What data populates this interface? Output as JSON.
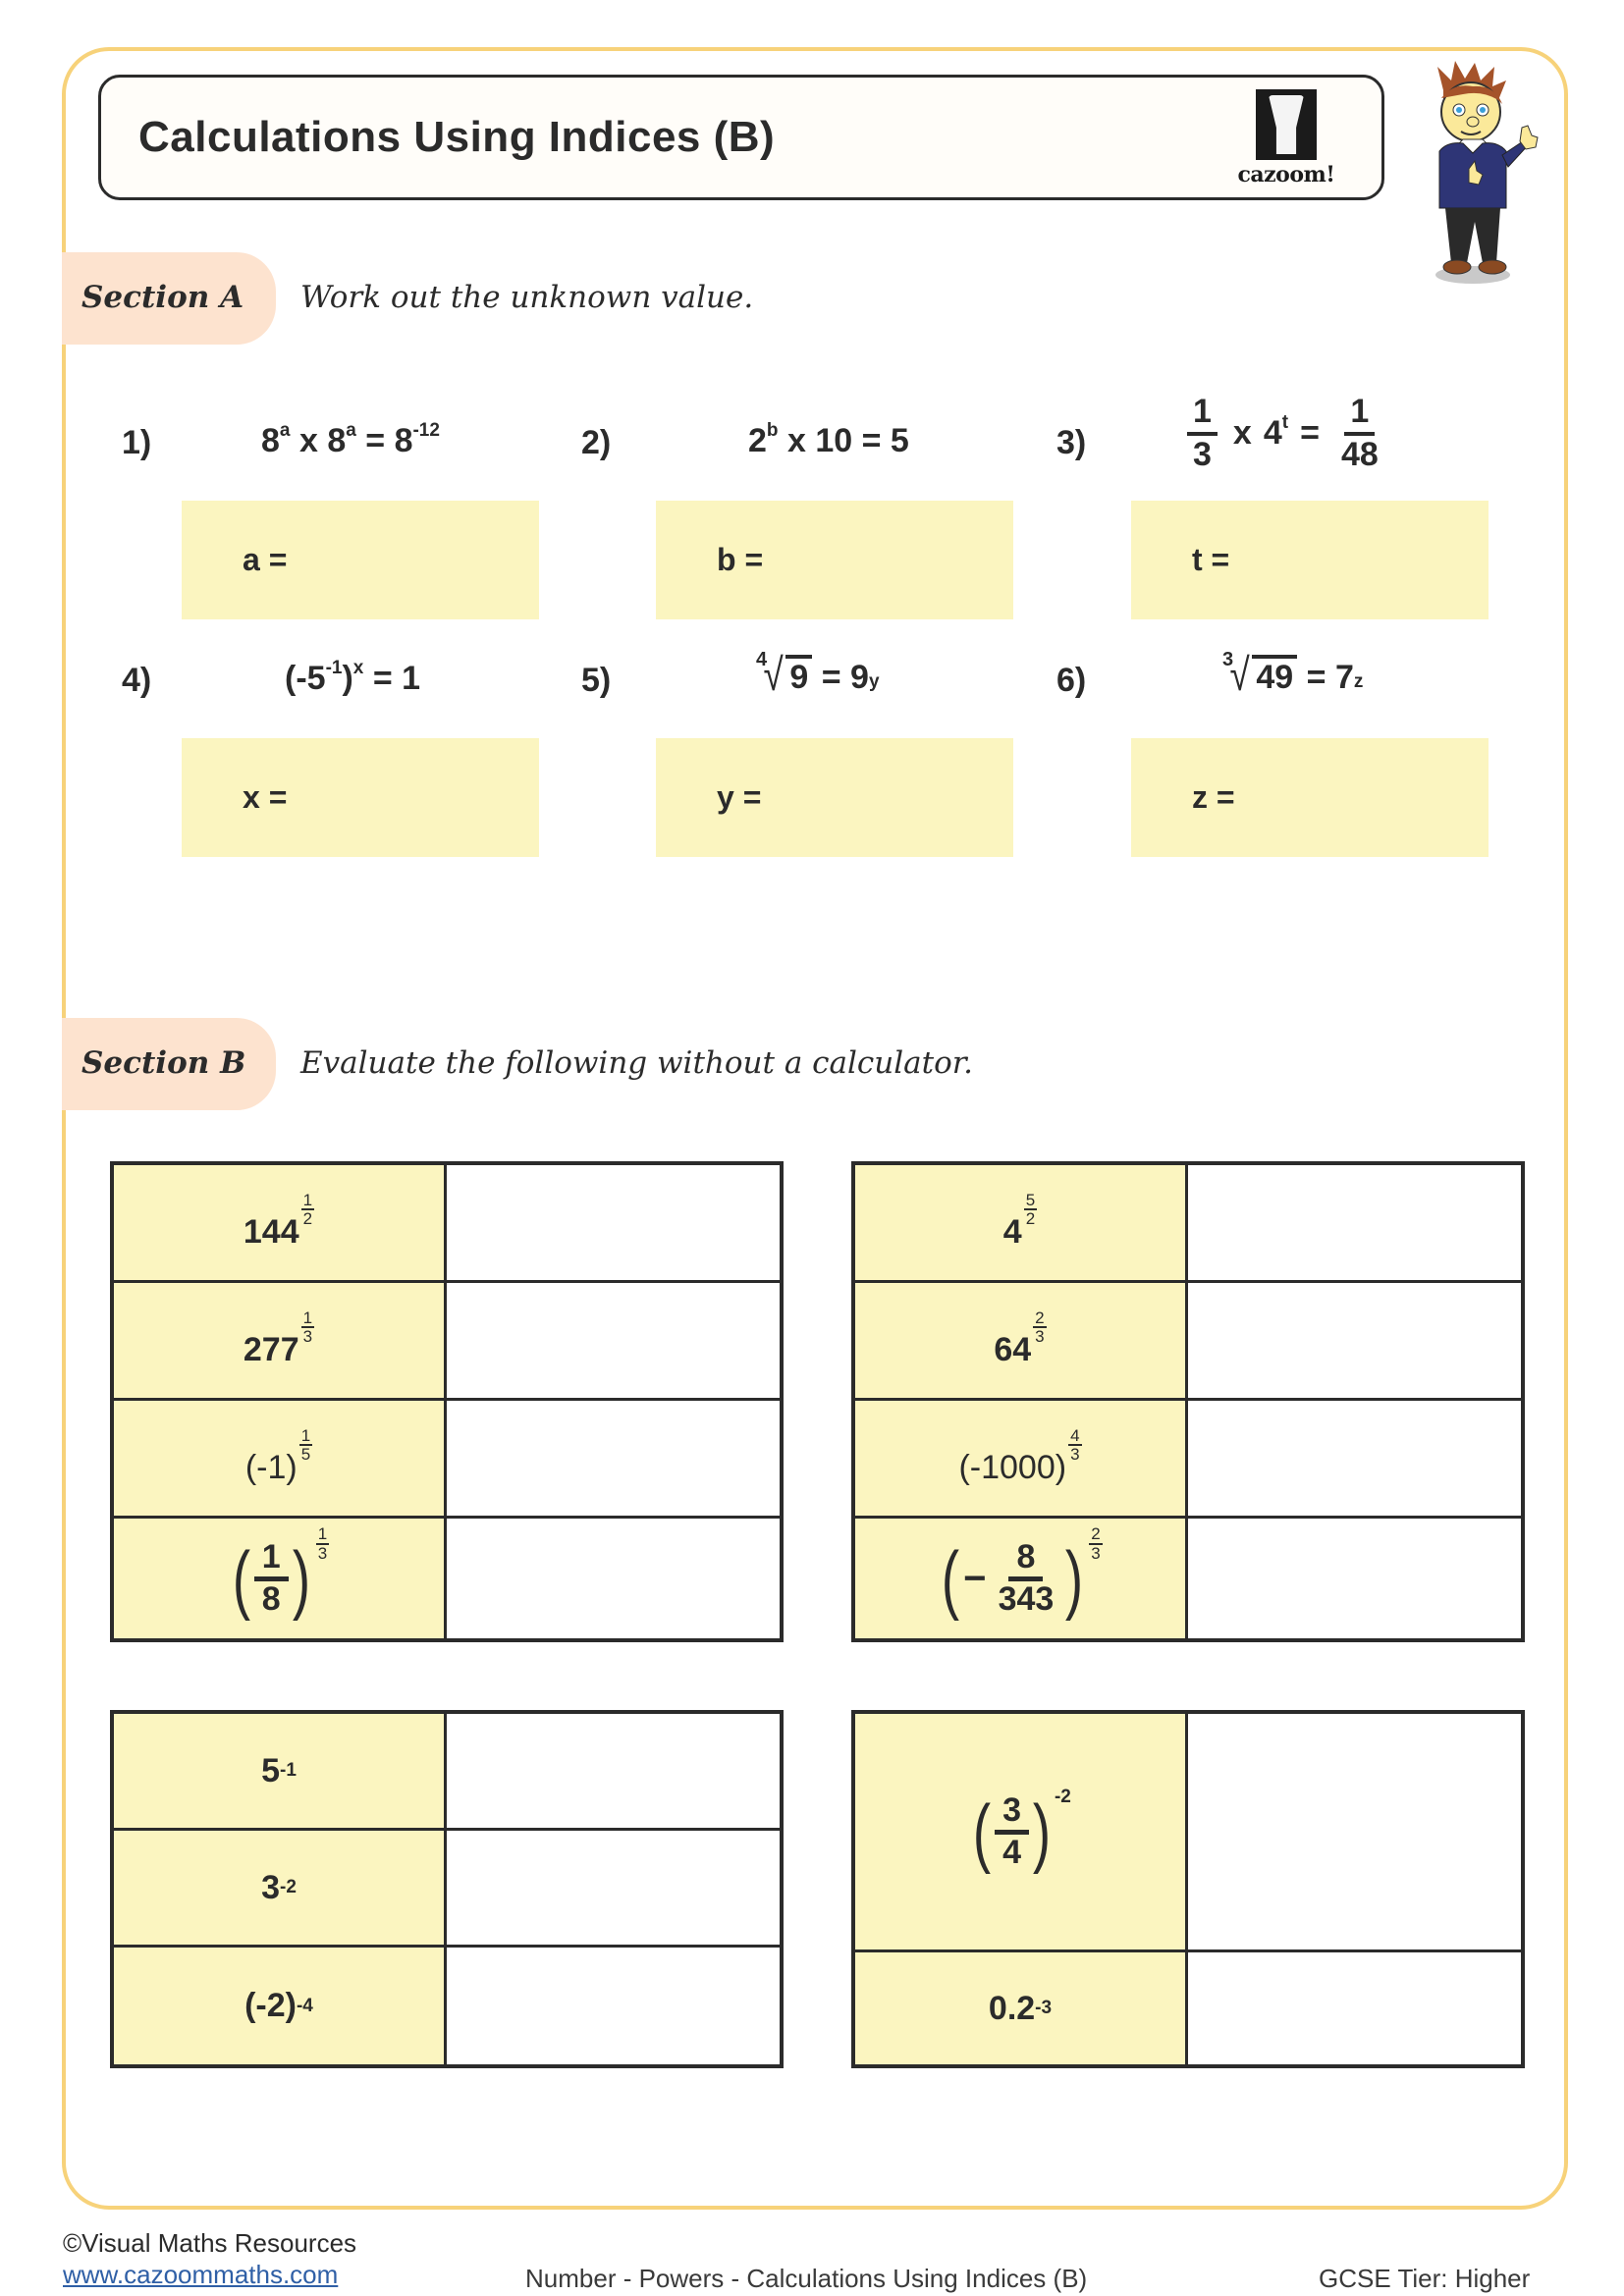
{
  "header": {
    "title": "Calculations Using Indices (B)",
    "logo_text": "cazoom!",
    "logo_icon": "cazoom-drum-logo-icon",
    "mascot_icon": "cartoon-boy-thumbs-up-icon"
  },
  "colors": {
    "frame_border": "#f7d27a",
    "section_pill": "#fde3cf",
    "answer_fill": "#fbf5c0",
    "text": "#2b2b2b",
    "link": "#2f5fa6"
  },
  "section_a": {
    "label": "Section A",
    "instruction": "Work out the unknown value.",
    "questions": [
      {
        "number": "1)",
        "expression": "8^a x 8^a = 8^-12",
        "answer_label": "a ="
      },
      {
        "number": "2)",
        "expression": "2^b x 10 = 5",
        "answer_label": "b ="
      },
      {
        "number": "3)",
        "expression": "1/3 x 4^t = 1/48",
        "answer_label": "t ="
      },
      {
        "number": "4)",
        "expression": "(-5^-1)^x = 1",
        "answer_label": "x ="
      },
      {
        "number": "5)",
        "expression": "4th root of 9 = 9^y",
        "answer_label": "y ="
      },
      {
        "number": "6)",
        "expression": "cube root of 49 = 7^z",
        "answer_label": "z ="
      }
    ],
    "parts": {
      "q1": {
        "b1": "8",
        "e1": "a",
        "op": " x ",
        "b2": "8",
        "e2": "a",
        "eq": " = ",
        "b3": "8",
        "e3": "-12"
      },
      "q2": {
        "b1": "2",
        "e1": "b",
        "rest": " x 10 = 5"
      },
      "q3": {
        "n1": "1",
        "d1": "3",
        "op": "x",
        "b": "4",
        "e": "t",
        "eq": "=",
        "n2": "1",
        "d2": "48"
      },
      "q4": {
        "open": "(-5",
        "e1": "-1",
        "close": ")",
        "e2": "x",
        "rest": " = 1"
      },
      "q5": {
        "idx": "4",
        "rad": "9",
        "eq": " = ",
        "b": "9",
        "e": "y"
      },
      "q6": {
        "idx": "3",
        "rad": "49",
        "eq": " = ",
        "b": "7",
        "e": "z"
      }
    }
  },
  "section_b": {
    "label": "Section B",
    "instruction": "Evaluate the following without a calculator.",
    "table1": [
      {
        "base": "144",
        "exp_num": "1",
        "exp_den": "2"
      },
      {
        "base": "277",
        "exp_num": "1",
        "exp_den": "3"
      },
      {
        "base": "(-1)",
        "exp_num": "1",
        "exp_den": "5"
      },
      {
        "frac_num": "1",
        "frac_den": "8",
        "exp_num": "1",
        "exp_den": "3"
      }
    ],
    "table2": [
      {
        "base": "4",
        "exp_num": "5",
        "exp_den": "2"
      },
      {
        "base": "64",
        "exp_num": "2",
        "exp_den": "3"
      },
      {
        "base": "(-1000)",
        "exp_num": "4",
        "exp_den": "3"
      },
      {
        "sign": "−",
        "frac_num": "8",
        "frac_den": "343",
        "exp_num": "2",
        "exp_den": "3"
      }
    ],
    "table3": [
      {
        "base": "5",
        "exp": "-1"
      },
      {
        "base": "3",
        "exp": "-2"
      },
      {
        "base": "(-2)",
        "exp": "-4"
      }
    ],
    "table4": [
      {
        "frac_num": "3",
        "frac_den": "4",
        "exp": "-2"
      },
      {
        "base": "0.2",
        "exp": "-3"
      }
    ]
  },
  "footer": {
    "copyright": "©Visual Maths Resources",
    "website": "www.cazoommaths.com",
    "topic": "Number - Powers - Calculations Using Indices (B)",
    "tier": "GCSE Tier: Higher"
  }
}
